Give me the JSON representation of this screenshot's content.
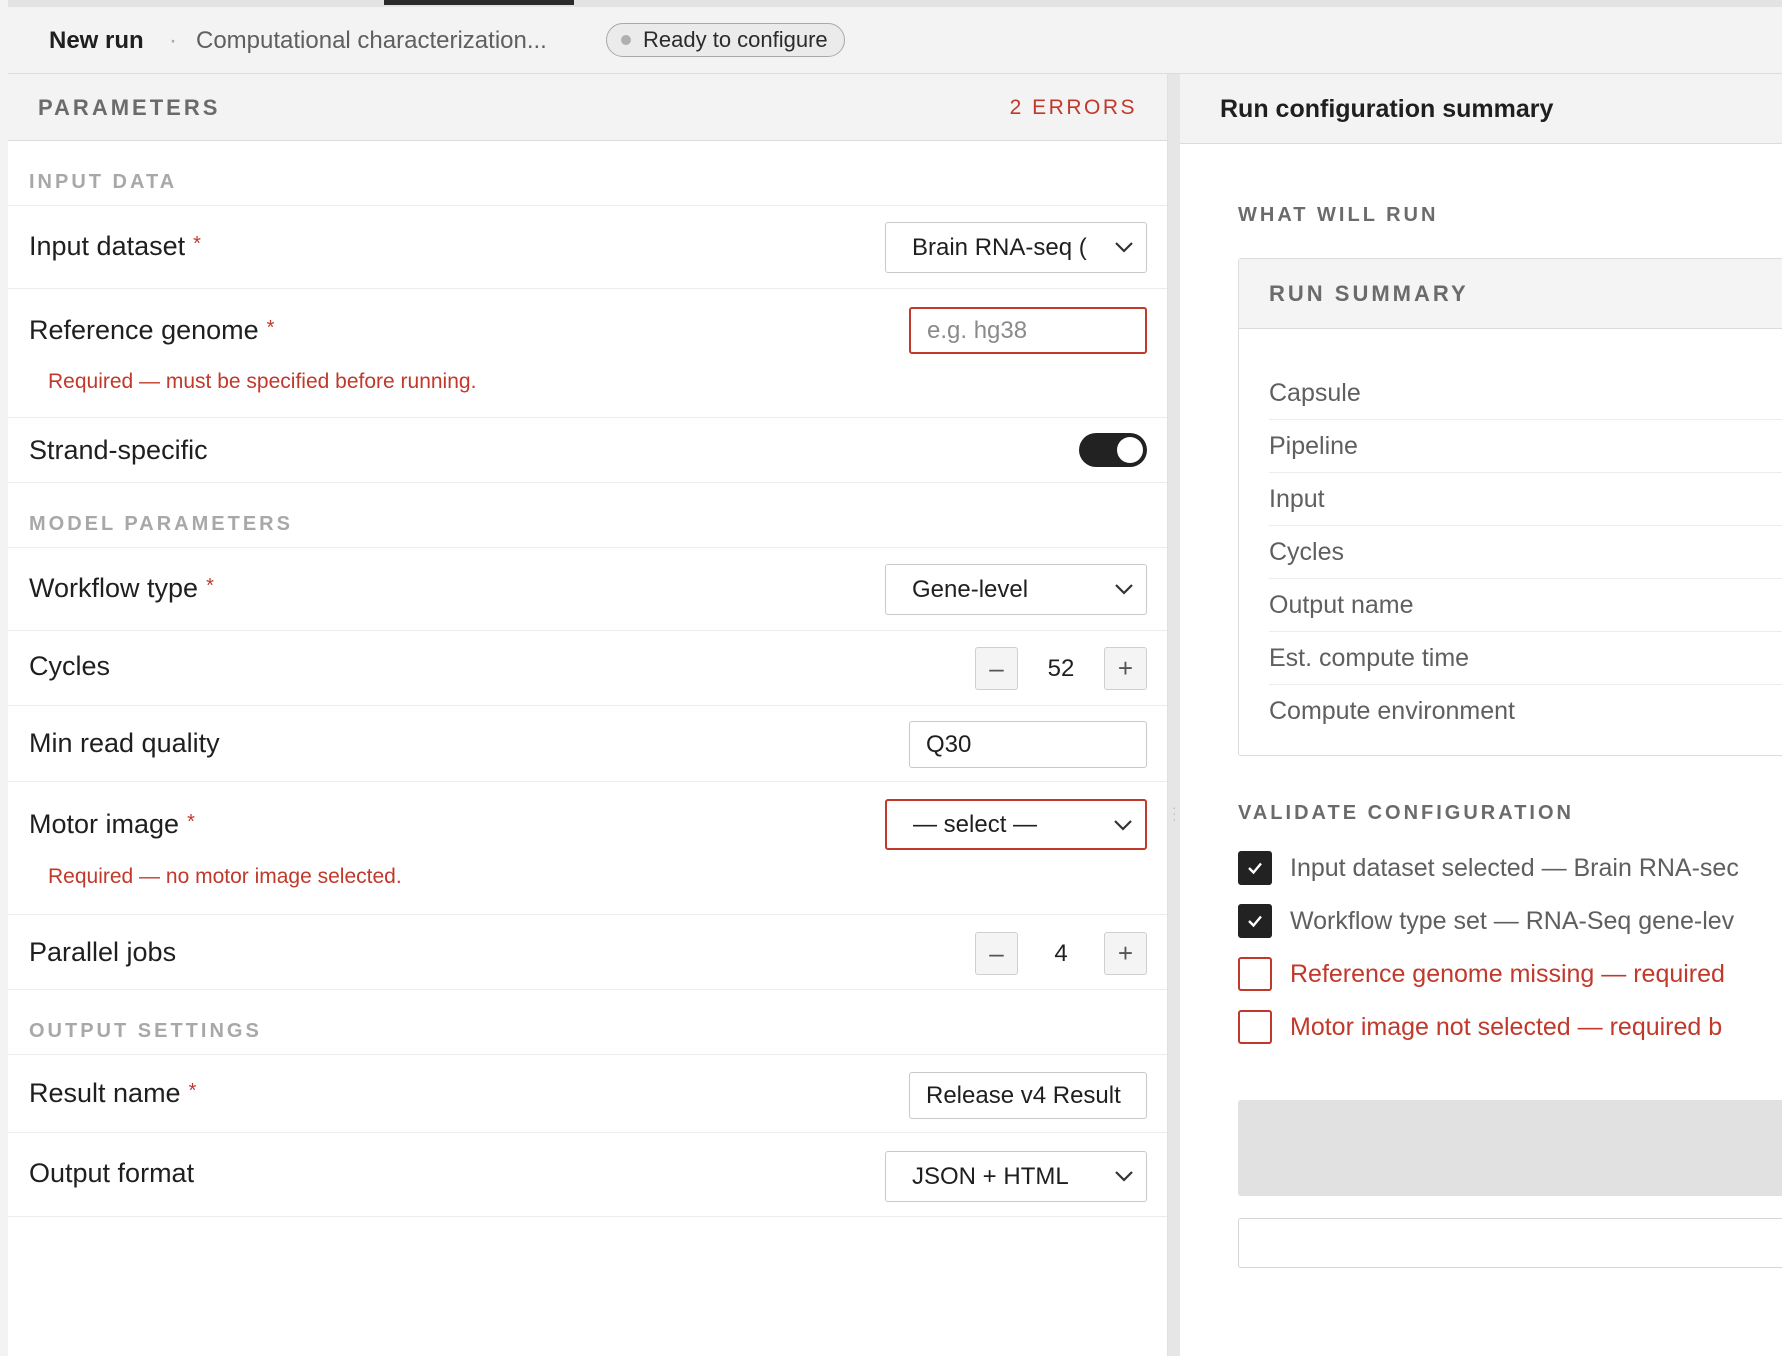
{
  "header": {
    "new_run": "New run",
    "separator": "·",
    "title": "Computational characterization...",
    "status": "Ready to configure"
  },
  "parameters": {
    "title": "PARAMETERS",
    "errors": "2 ERRORS",
    "sections": {
      "input_data": "INPUT DATA",
      "model_parameters": "MODEL PARAMETERS",
      "output_settings": "OUTPUT SETTINGS"
    },
    "required_mark": "*",
    "input_dataset": {
      "label": "Input dataset",
      "value": "Brain RNA-seq ("
    },
    "reference_genome": {
      "label": "Reference genome",
      "placeholder": "e.g. hg38",
      "value": "",
      "error": "Required — must be specified before running."
    },
    "strand_specific": {
      "label": "Strand-specific",
      "on": true
    },
    "workflow_type": {
      "label": "Workflow type",
      "value": "Gene-level"
    },
    "cycles": {
      "label": "Cycles",
      "value": "52",
      "minus": "–",
      "plus": "+"
    },
    "min_read_quality": {
      "label": "Min read quality",
      "value": "Q30"
    },
    "motor_image": {
      "label": "Motor image",
      "value": "— select —",
      "error": "Required — no motor image selected."
    },
    "parallel_jobs": {
      "label": "Parallel jobs",
      "value": "4",
      "minus": "–",
      "plus": "+"
    },
    "result_name": {
      "label": "Result name",
      "value": "Release v4 Result"
    },
    "output_format": {
      "label": "Output format",
      "value": "JSON + HTML"
    }
  },
  "summary": {
    "title": "Run configuration summary",
    "what_will_run": "WHAT WILL RUN",
    "card_title": "RUN SUMMARY",
    "items": [
      "Capsule",
      "Pipeline",
      "Input",
      "Cycles",
      "Output name",
      "Est. compute time",
      "Compute environment"
    ],
    "validate_title": "VALIDATE CONFIGURATION",
    "checks": [
      {
        "text": "Input dataset selected — Brain RNA-sec",
        "checked": true
      },
      {
        "text": "Workflow type set — RNA-Seq gene-lev",
        "checked": true
      },
      {
        "text": "Reference genome missing — required",
        "checked": false
      },
      {
        "text": "Motor image not selected — required b",
        "checked": false
      }
    ]
  },
  "colors": {
    "error": "#c0392b",
    "toggle_on": "#222222",
    "panel_header": "#f3f3f3"
  }
}
